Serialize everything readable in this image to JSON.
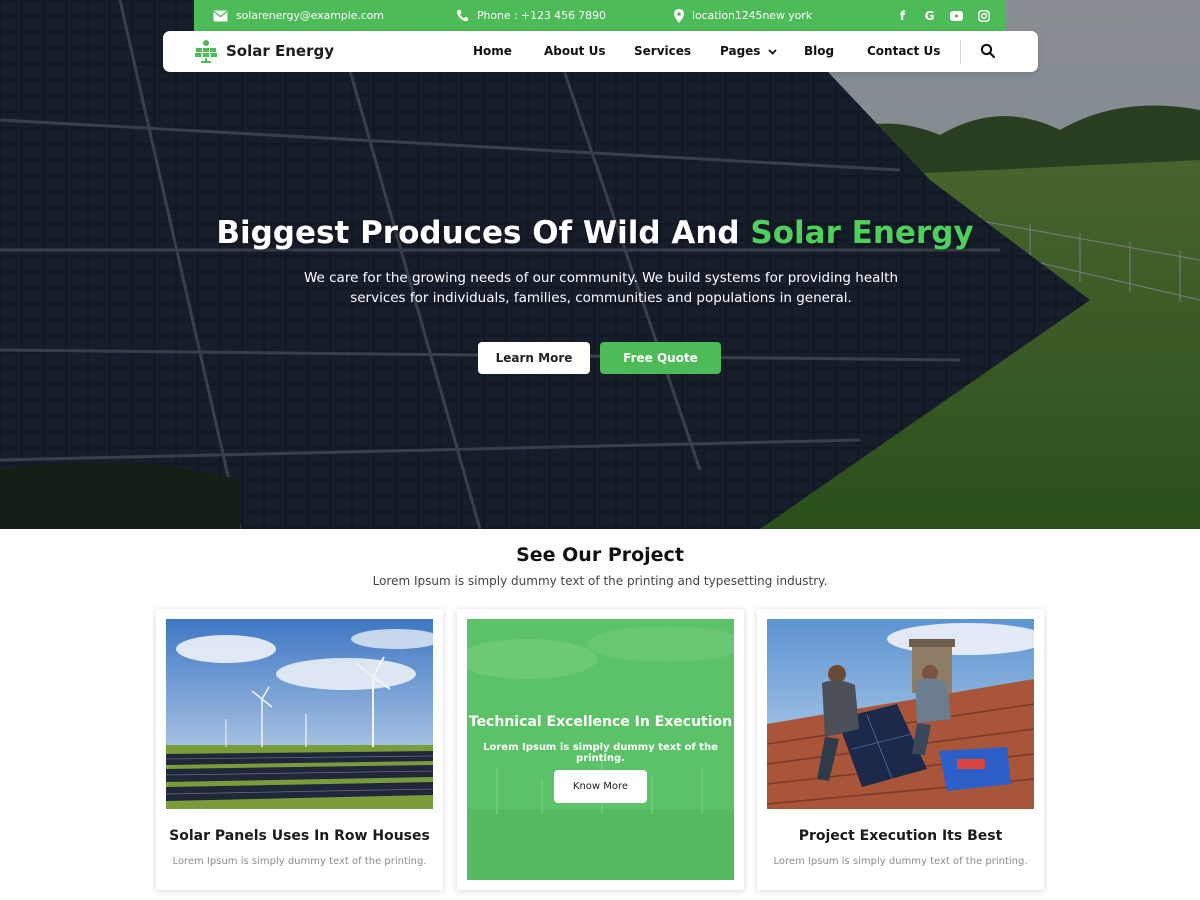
{
  "topbar": {
    "email": "solarenergy@example.com",
    "phone": "Phone : +123 456 7890",
    "location": "location1245new york",
    "social": [
      "facebook-icon",
      "google-icon",
      "youtube-icon",
      "instagram-icon"
    ]
  },
  "nav": {
    "brand": "Solar Energy",
    "links": [
      "Home",
      "About Us",
      "Services",
      "Pages",
      "Blog",
      "Contact Us"
    ]
  },
  "hero": {
    "title_main": "Biggest Produces Of Wild And ",
    "title_accent": "Solar Energy",
    "subtitle": "We care for the growing needs of our community. We build systems for providing health services for individuals, families, communities and populations in general.",
    "btn_learn": "Learn More",
    "btn_quote": "Free Quote"
  },
  "projects": {
    "title": "See Our Project",
    "subtitle": "Lorem Ipsum is simply dummy text of the printing and typesetting industry.",
    "cards": [
      {
        "title": "Solar Panels Uses In Row Houses",
        "text": "Lorem Ipsum is simply dummy text of the printing."
      },
      {
        "title": "Technical Excellence In Execution",
        "text": "Lorem Ipsum is simply dummy text of the printing.",
        "button": "Know More"
      },
      {
        "title": "Project Execution Its Best",
        "text": "Lorem Ipsum is simply dummy text of the printing."
      }
    ]
  },
  "colors": {
    "accent": "#4cbb58",
    "hero_accent": "#4fcf5b",
    "dark": "#111111"
  }
}
